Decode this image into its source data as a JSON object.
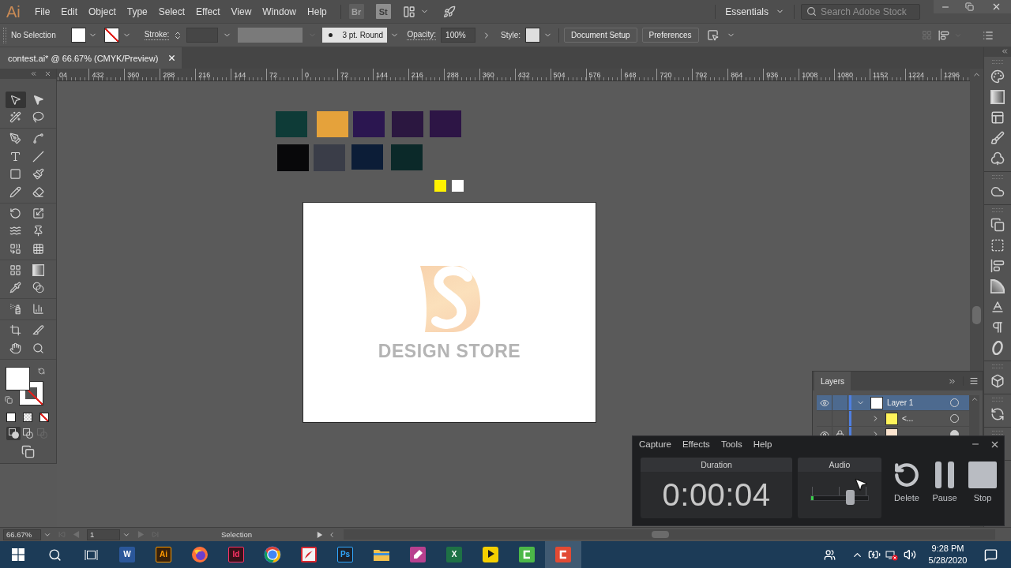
{
  "menubar": {
    "logo": "Ai",
    "menus": [
      "File",
      "Edit",
      "Object",
      "Type",
      "Select",
      "Effect",
      "View",
      "Window",
      "Help"
    ],
    "app_tiles": [
      {
        "label": "Br",
        "disabled": true
      },
      {
        "label": "St",
        "disabled": false
      }
    ],
    "workspace": "Essentials",
    "search": {
      "placeholder": "Search Adobe Stock"
    }
  },
  "control_bar": {
    "selection": "No Selection",
    "stroke_label": "Stroke:",
    "brush": "3 pt. Round",
    "opacity_label": "Opacity:",
    "opacity": "100%",
    "style_label": "Style:",
    "buttons": [
      "Document Setup",
      "Preferences"
    ]
  },
  "document_tab": {
    "title": "contest.ai* @ 66.67% (CMYK/Preview)",
    "selected": true
  },
  "ruler": {
    "labels": [
      "04",
      "432",
      "360",
      "288",
      "216",
      "144",
      "72",
      "0",
      "72",
      "144",
      "216",
      "288",
      "360",
      "432",
      "504",
      "576",
      "648",
      "720",
      "792",
      "864",
      "936",
      "1008",
      "1080",
      "1152",
      "1224",
      "1296"
    ]
  },
  "tools": [
    {
      "selected": true
    },
    {
      "selected": false
    },
    {
      "selected": false
    },
    {
      "selected": false
    },
    {
      "selected": false
    },
    {
      "selected": false
    },
    {
      "selected": false
    },
    {
      "selected": false
    },
    {
      "selected": false
    },
    {
      "selected": false
    },
    {
      "selected": false
    },
    {
      "selected": false
    },
    {
      "selected": false
    },
    {
      "selected": false
    },
    {
      "selected": false
    },
    {
      "selected": false
    },
    {
      "selected": false
    },
    {
      "selected": false
    },
    {
      "selected": false
    },
    {
      "selected": false
    },
    {
      "selected": false
    },
    {
      "selected": false
    },
    {
      "selected": false
    },
    {
      "selected": false
    },
    {
      "selected": false
    },
    {
      "selected": false
    },
    {
      "selected": false
    },
    {
      "selected": false
    }
  ],
  "draw_modes": [
    {
      "selected": true,
      "disabled": false
    },
    {
      "selected": false,
      "disabled": false
    },
    {
      "selected": false,
      "disabled": true
    }
  ],
  "artwork": {
    "swatches": [
      {
        "color": "#0e3b37"
      },
      {
        "color": "#e5a23b"
      },
      {
        "color": "#2b1650"
      },
      {
        "color": "#2b1740"
      },
      {
        "color": "#2d1545"
      },
      {
        "color": "#08080a"
      },
      {
        "color": "#3a3d48"
      },
      {
        "color": "#0c1d37"
      },
      {
        "color": "#0b2929"
      },
      {
        "color": "#fff200"
      },
      {
        "color": "#ffffff"
      }
    ],
    "logo_text": "DESIGN STORE"
  },
  "layers_panel": {
    "title": "Layers",
    "layers": [
      {
        "name": "Layer 1",
        "visible": true,
        "locked": false,
        "expanded": true,
        "selected": true,
        "target_filled": false,
        "color": "#ffffff",
        "children": [
          {
            "name": "<...",
            "visible": false,
            "locked": false,
            "expanded": false,
            "selected": false,
            "target_filled": false,
            "color": "#fff35a"
          },
          {
            "visible": true,
            "locked": true,
            "expanded": false,
            "selected": false,
            "target_filled": true,
            "color": "#fbe4cf"
          }
        ]
      }
    ]
  },
  "capture_window": {
    "menus": [
      "Capture",
      "Effects",
      "Tools",
      "Help"
    ],
    "duration": {
      "label": "Duration",
      "value": "0:00:04"
    },
    "audio": {
      "label": "Audio",
      "level": 0.68
    },
    "buttons": [
      {
        "kind": "delete",
        "label": "Delete"
      },
      {
        "kind": "pause",
        "label": "Pause"
      },
      {
        "kind": "stop",
        "label": "Stop"
      }
    ]
  },
  "status_bar": {
    "zoom": "66.67%",
    "artboard": "1",
    "tool": "Selection"
  },
  "taskbar": {
    "apps": [
      {
        "kind": "letter_tile",
        "label": "W",
        "color": "#2b579a",
        "selected": false
      },
      {
        "kind": "outline_tile",
        "label": "Ai",
        "color": "#ff9a00",
        "selected": false
      },
      {
        "kind": "orb",
        "color": "#ff7139",
        "selected": false
      },
      {
        "kind": "outline_tile",
        "label": "Id",
        "color": "#ff3366",
        "selected": false
      },
      {
        "kind": "ring",
        "color": "#4285f4",
        "selected": false
      },
      {
        "kind": "doc",
        "color": "#d8262f",
        "selected": false
      },
      {
        "kind": "outline_tile",
        "label": "Ps",
        "color": "#31a8ff",
        "selected": false
      },
      {
        "kind": "folder",
        "color": "#f2c14e",
        "selected": false
      },
      {
        "kind": "mic_tile",
        "color": "#b8408f",
        "selected": false
      },
      {
        "kind": "letter_tile",
        "label": "X",
        "color": "#1e7145",
        "selected": false
      },
      {
        "kind": "play_tile",
        "color": "#f5d000",
        "selected": false
      },
      {
        "kind": "c_tile",
        "color": "#4cb848",
        "selected": false
      },
      {
        "kind": "c_tile",
        "color": "#e24a33",
        "selected": true
      }
    ],
    "time": "9:28 PM",
    "date": "5/28/2020"
  }
}
